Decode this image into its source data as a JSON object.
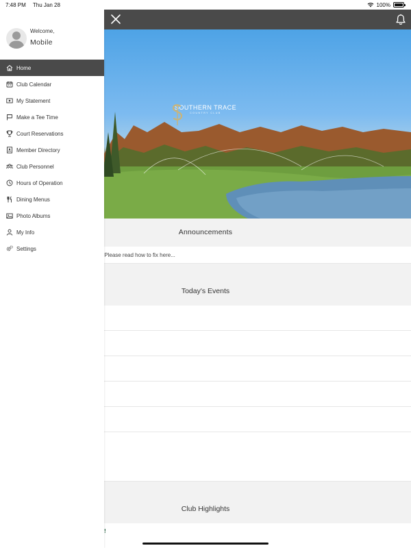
{
  "status_bar": {
    "time": "7:48 PM",
    "date": "Thu Jan 28",
    "battery": "100%"
  },
  "colors": {
    "toolbar": "#4a4a4a",
    "section_bg": "#f2f2f2",
    "highlight_text": "#1d5b3a"
  },
  "profile": {
    "welcome": "Welcome,",
    "name": "Mobile"
  },
  "menu": [
    {
      "label": "Home",
      "icon": "home-icon",
      "active": true
    },
    {
      "label": "Club Calendar",
      "icon": "calendar-icon"
    },
    {
      "label": "My Statement",
      "icon": "statement-icon"
    },
    {
      "label": "Make a Tee Time",
      "icon": "golf-flag-icon"
    },
    {
      "label": "Court Reservations",
      "icon": "trophy-icon"
    },
    {
      "label": "Member Directory",
      "icon": "directory-icon"
    },
    {
      "label": "Club Personnel",
      "icon": "personnel-icon"
    },
    {
      "label": "Hours of Operation",
      "icon": "clock-icon"
    },
    {
      "label": "Dining Menus",
      "icon": "dining-icon"
    },
    {
      "label": "Photo Albums",
      "icon": "photo-icon"
    },
    {
      "label": "My Info",
      "icon": "user-icon"
    },
    {
      "label": "Settings",
      "icon": "settings-icon"
    }
  ],
  "hero": {
    "logo_text": "SOUTHERN TRACE",
    "logo_sub": "COUNTRY CLUB"
  },
  "announcements": {
    "title": "Announcements",
    "items": [
      "ns on iPad. Please read how to fix here..."
    ]
  },
  "events": {
    "title": "Today's Events"
  },
  "highlights": {
    "title": "Club Highlights",
    "items": [
      "mily!"
    ]
  }
}
